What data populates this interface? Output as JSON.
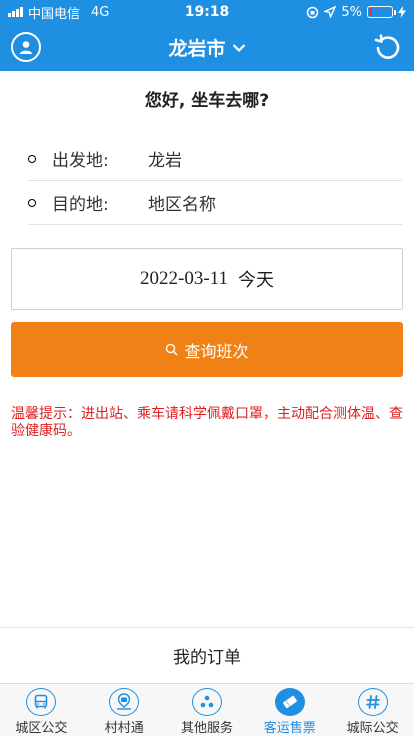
{
  "status_bar": {
    "carrier": "中国电信",
    "network": "4G",
    "time": "19:18",
    "battery": "5%"
  },
  "nav": {
    "city": "龙岩市"
  },
  "greeting": "您好, 坐车去哪?",
  "route": {
    "from_label": "出发地:",
    "from_value": "龙岩",
    "to_label": "目的地:",
    "to_placeholder": "地区名称"
  },
  "date": {
    "value": "2022-03-11",
    "day": "今天"
  },
  "search_label": "查询班次",
  "notice": "温馨提示：进出站、乘车请科学佩戴口罩，主动配合测体温、查验健康码。",
  "orders_label": "我的订单",
  "tabs": [
    {
      "label": "城区公交",
      "icon": "bus-icon"
    },
    {
      "label": "村村通",
      "icon": "village-bus-icon"
    },
    {
      "label": "其他服务",
      "icon": "services-icon"
    },
    {
      "label": "客运售票",
      "icon": "ticket-icon"
    },
    {
      "label": "城际公交",
      "icon": "hash-icon"
    }
  ],
  "active_tab_index": 3,
  "colors": {
    "primary": "#1e8fe1",
    "accent": "#f08116",
    "notice": "#e02020"
  }
}
